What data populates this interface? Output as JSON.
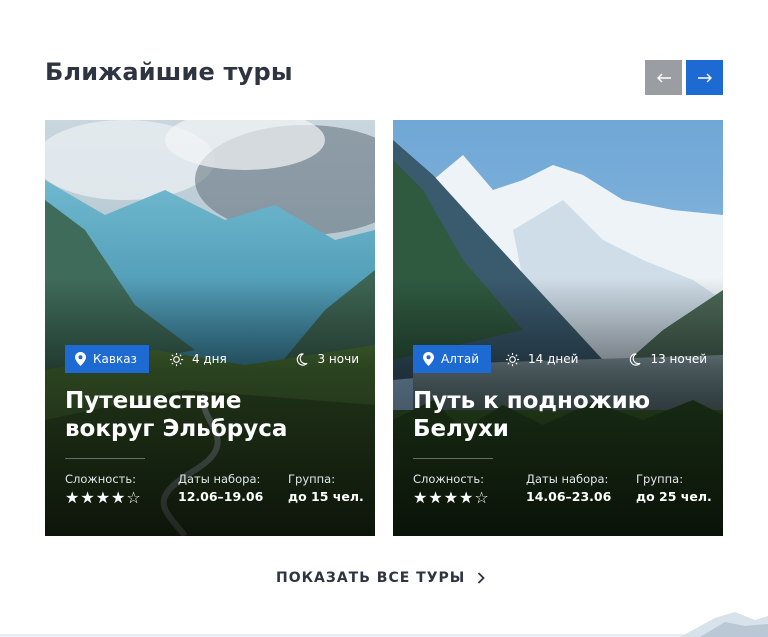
{
  "section": {
    "title": "Ближайшие туры",
    "prev_icon": "arrow-left-icon",
    "next_icon": "arrow-right-icon"
  },
  "tours": [
    {
      "region": "Кавказ",
      "days": "4 дня",
      "nights": "3 ночи",
      "title_line1": "Путешествие",
      "title_line2": "вокруг Эльбруса",
      "difficulty_label": "Сложность:",
      "difficulty_stars": "★★★★☆",
      "difficulty_rating": 4,
      "dates_label": "Даты набора:",
      "dates_value": "12.06–19.06",
      "group_label": "Группа:",
      "group_value": "до 15 чел."
    },
    {
      "region": "Алтай",
      "days": "14 дней",
      "nights": "13 ночей",
      "title_line1": "Путь к подножию",
      "title_line2": "Белухи",
      "difficulty_label": "Сложность:",
      "difficulty_stars": "★★★★☆",
      "difficulty_rating": 4,
      "dates_label": "Даты набора:",
      "dates_value": "14.06–23.06",
      "group_label": "Группа:",
      "group_value": "до 25 чел."
    }
  ],
  "show_all": {
    "label": "ПОКАЗАТЬ ВСЕ ТУРЫ",
    "icon": "chevron-right-icon"
  },
  "colors": {
    "accent": "#1d6ad2",
    "nav_disabled": "#9a9ea3",
    "heading": "#2e3440"
  }
}
